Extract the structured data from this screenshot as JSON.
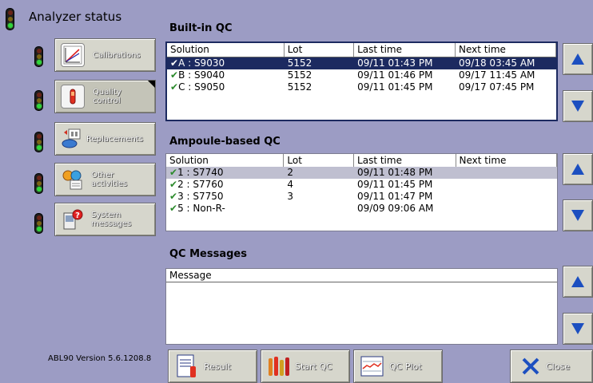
{
  "left": {
    "title": "Analyzer status",
    "nav": [
      {
        "label": "Calibrations",
        "light": "green"
      },
      {
        "label": "Quality\ncontrol",
        "light": "green"
      },
      {
        "label": "Replacements",
        "light": "green"
      },
      {
        "label": "Other\nactivities",
        "light": "green"
      },
      {
        "label": "System\nmessages",
        "light": "green"
      }
    ],
    "version": "ABL90 Version 5.6.1208.8"
  },
  "builtin": {
    "title": "Built-in QC",
    "headers": [
      "Solution",
      "Lot",
      "Last time",
      "Next time"
    ],
    "rows": [
      {
        "solution": "A : S9030",
        "lot": "5152",
        "last": "09/11 01:43 PM",
        "next": "09/18 03:45 AM",
        "selected": true
      },
      {
        "solution": "B : S9040",
        "lot": "5152",
        "last": "09/11 01:46 PM",
        "next": "09/17 11:45 AM"
      },
      {
        "solution": "C : S9050",
        "lot": "5152",
        "last": "09/11 01:45 PM",
        "next": "09/17 07:45 PM"
      }
    ]
  },
  "ampoule": {
    "title": "Ampoule-based QC",
    "headers": [
      "Solution",
      "Lot",
      "Last time",
      "Next time"
    ],
    "rows": [
      {
        "solution": "1 : S7740",
        "lot": "2",
        "last": "09/11 01:48 PM",
        "next": "",
        "selected": true
      },
      {
        "solution": "2 : S7760",
        "lot": "4",
        "last": "09/11 01:45 PM",
        "next": ""
      },
      {
        "solution": "3 : S7750",
        "lot": "3",
        "last": "09/11 01:47 PM",
        "next": ""
      },
      {
        "solution": "5 : Non-R-",
        "lot": "",
        "last": "09/09 09:06 AM",
        "next": ""
      }
    ]
  },
  "messages": {
    "title": "QC Messages",
    "header": "Message"
  },
  "bottom": {
    "result": "Result",
    "start_qc": "Start QC",
    "qc_plot": "QC Plot",
    "close": "Close"
  },
  "check_glyph": "✔",
  "colors": {
    "background": "#9c9cc4",
    "selection": "#1c2a60",
    "arrow": "#1c4fc0"
  }
}
